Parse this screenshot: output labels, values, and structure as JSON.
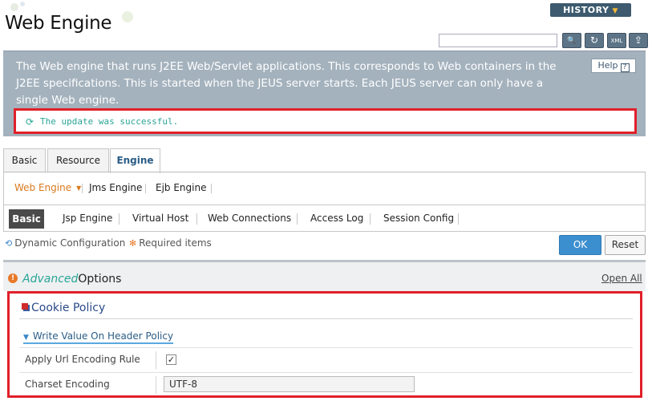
{
  "page": {
    "title": "Web Engine"
  },
  "header": {
    "history_label": "HISTORY",
    "search_placeholder": ""
  },
  "toolbar": [
    {
      "name": "search-icon",
      "glyph": "🔍"
    },
    {
      "name": "refresh-icon",
      "glyph": "↻"
    },
    {
      "name": "xml-icon",
      "glyph": "XML"
    },
    {
      "name": "export-icon",
      "glyph": "⇪"
    }
  ],
  "info": {
    "description": "The Web engine that runs J2EE Web/Servlet applications. This corresponds to Web containers in the J2EE specifications. This is started when the JEUS server starts. Each JEUS server can only have a single Web engine.",
    "help_label": "Help",
    "message": "The update was successful."
  },
  "main_tabs": [
    "Basic",
    "Resource",
    "Engine"
  ],
  "sub_tabs": [
    "Web Engine",
    "Jms Engine",
    "Ejb Engine"
  ],
  "section_tabs": [
    "Basic",
    "Jsp Engine",
    "Virtual Host",
    "Web Connections",
    "Access Log",
    "Session Config"
  ],
  "legend": {
    "dynamic": "Dynamic Configuration",
    "required": "Required items"
  },
  "buttons": {
    "ok": "OK",
    "reset": "Reset"
  },
  "advanced": {
    "prefix": "Advanced",
    "suffix": "Options",
    "open_all": "Open All"
  },
  "cookie_policy": {
    "title": "Cookie Policy",
    "section": "Write Value On Header Policy",
    "fields": [
      {
        "label": "Apply Url Encoding Rule",
        "checked": true
      },
      {
        "label": "Charset Encoding",
        "value": "UTF-8"
      }
    ]
  },
  "colors": {
    "accent": "#3c8fcf",
    "highlight": "#e0202a",
    "success": "#2aa597",
    "active_sub": "#d9791e"
  }
}
